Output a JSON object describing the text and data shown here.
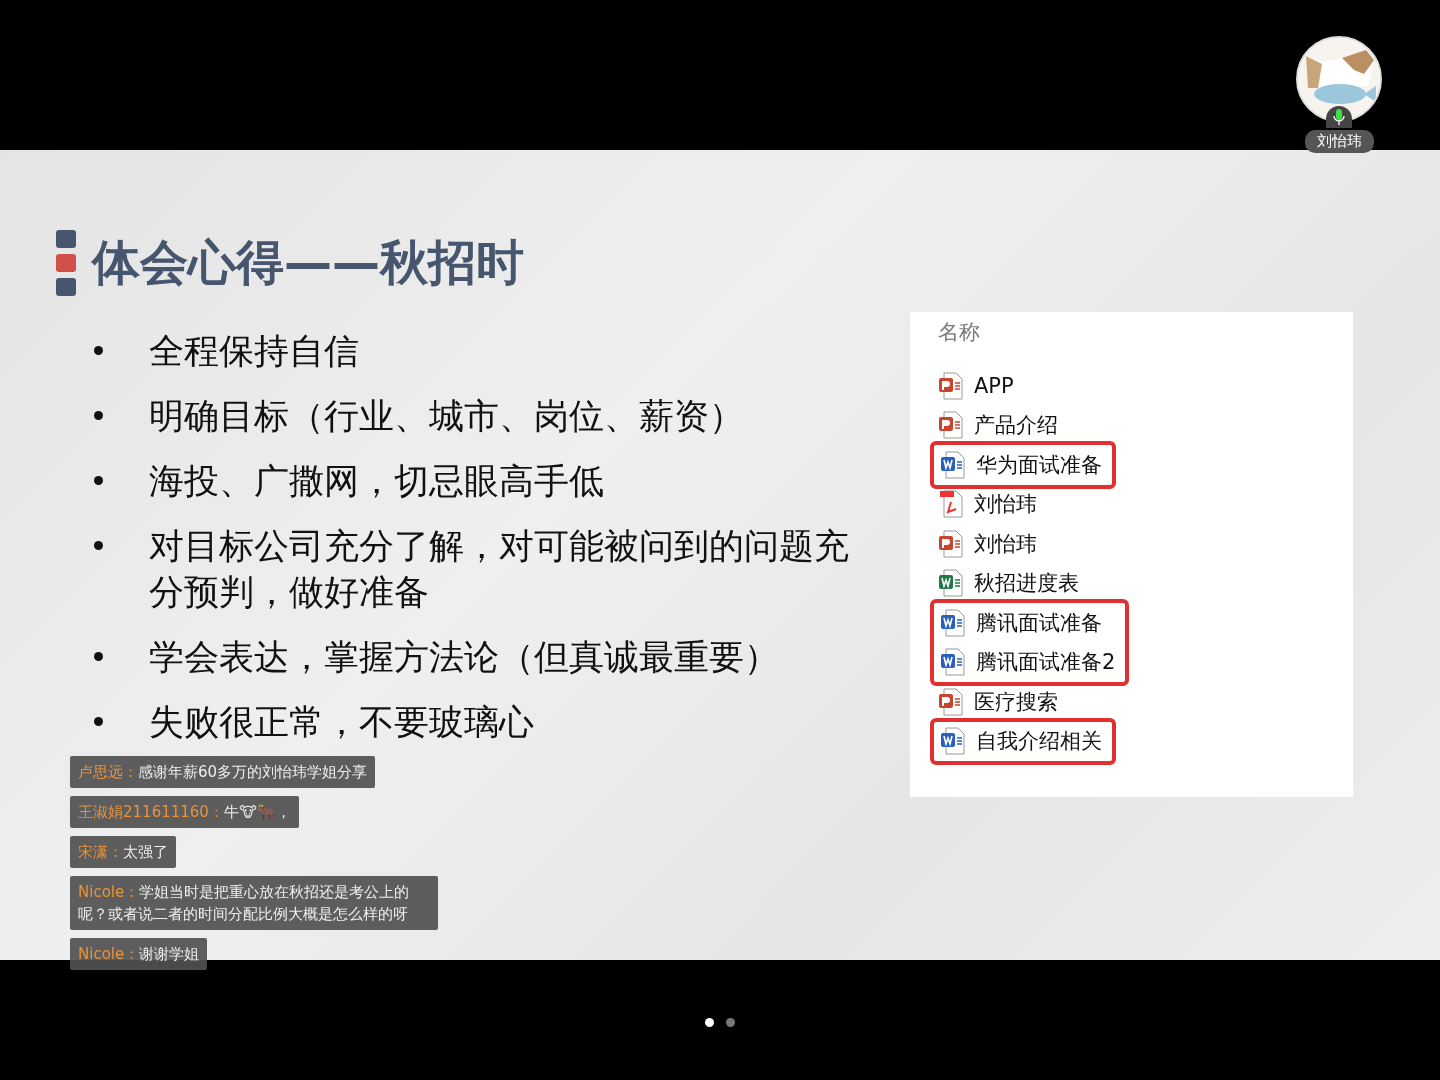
{
  "presenter": {
    "name": "刘怡玮",
    "mic_on": true
  },
  "slide": {
    "title": "体会心得——秋招时",
    "bullets": [
      "全程保持自信",
      "明确目标（行业、城市、岗位、薪资）",
      "海投、广撒网，切忌眼高手低",
      "对目标公司充分了解，对可能被问到的问题充分预判，做好准备",
      "学会表达，掌握方法论（但真诚最重要）",
      "失败很正常，不要玻璃心"
    ],
    "file_list": {
      "header": "名称",
      "items": [
        {
          "kind": "ppt",
          "name": "APP",
          "highlighted": false
        },
        {
          "kind": "ppt",
          "name": "产品介绍",
          "highlighted": false
        },
        {
          "kind": "word",
          "name": "华为面试准备",
          "highlighted": true
        },
        {
          "kind": "pdf",
          "name": "刘怡玮",
          "highlighted": false
        },
        {
          "kind": "ppt",
          "name": "刘怡玮",
          "highlighted": false
        },
        {
          "kind": "excel",
          "name": "秋招进度表",
          "highlighted": false
        },
        {
          "kind": "word",
          "name": "腾讯面试准备",
          "highlighted": true
        },
        {
          "kind": "word",
          "name": "腾讯面试准备2",
          "highlighted": true
        },
        {
          "kind": "ppt",
          "name": "医疗搜索",
          "highlighted": false
        },
        {
          "kind": "word",
          "name": "自我介绍相关",
          "highlighted": true
        }
      ]
    }
  },
  "chat": [
    {
      "sender": "卢思远：",
      "text": "感谢年薪60多万的刘怡玮学姐分享"
    },
    {
      "sender": "王淑娟211611160：",
      "text": "牛🐮🐂，"
    },
    {
      "sender": "宋潇：",
      "text": "太强了"
    },
    {
      "sender": "Nicole：",
      "text": "学姐当时是把重心放在秋招还是考公上的呢？或者说二者的时间分配比例大概是怎么样的呀"
    },
    {
      "sender": "Nicole：",
      "text": "谢谢学姐"
    }
  ],
  "pager": [
    {
      "selected": true
    },
    {
      "selected": false
    }
  ]
}
